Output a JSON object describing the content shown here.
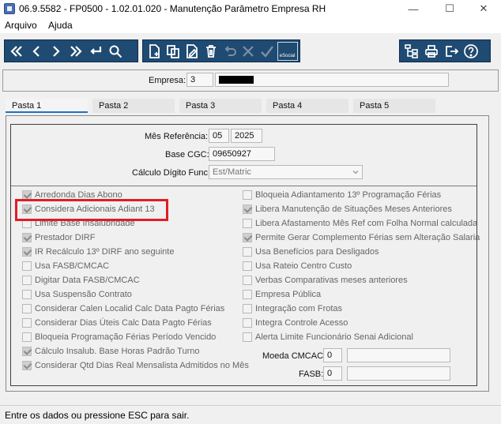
{
  "window": {
    "title": "06.9.5582 - FP0500 - 1.02.01.020 - Manutenção Parâmetro Empresa RH",
    "minimize": "—",
    "maximize": "☐",
    "close": "✕"
  },
  "menu": {
    "items": [
      "Arquivo",
      "Ajuda"
    ]
  },
  "toolbar": {
    "esocial_label": "eSocial"
  },
  "empresa": {
    "label": "Empresa:",
    "code": "3",
    "name_redacted": "",
    "extra": ""
  },
  "tabs": [
    "Pasta 1",
    "Pasta 2",
    "Pasta 3",
    "Pasta 4",
    "Pasta 5"
  ],
  "form": {
    "mes_referencia": {
      "label": "Mês Referência:",
      "month": "05",
      "year": "2025"
    },
    "base_cgc": {
      "label": "Base CGC:",
      "value": "09650927"
    },
    "calculo_digito": {
      "label": "Cálculo Dígito Func:",
      "value": "Est/Matric"
    }
  },
  "checkboxes_left": [
    {
      "label": "Arredonda Dias Abono",
      "checked": true
    },
    {
      "label": "Considera Adicionais Adiant 13",
      "checked": true
    },
    {
      "label": "Limite Base Insalubridade",
      "checked": false
    },
    {
      "label": "Prestador DIRF",
      "checked": true
    },
    {
      "label": "IR Recálculo 13º DIRF ano seguinte",
      "checked": true
    },
    {
      "label": "Usa FASB/CMCAC",
      "checked": false
    },
    {
      "label": "Digitar Data FASB/CMCAC",
      "checked": false
    },
    {
      "label": "Usa Suspensão Contrato",
      "checked": false
    },
    {
      "label": "Considerar Calen Localid Calc Data Pagto Férias",
      "checked": false
    },
    {
      "label": "Considerar Dias Úteis Calc Data Pagto Férias",
      "checked": false
    },
    {
      "label": "Bloqueia Programação Férias Período Vencido",
      "checked": false
    },
    {
      "label": "Cálculo Insalub. Base Horas Padrão Turno",
      "checked": true
    },
    {
      "label": "Considerar Qtd Dias Real Mensalista Admitidos no Mês",
      "checked": true
    }
  ],
  "checkboxes_right": [
    {
      "label": "Bloqueia Adiantamento 13º Programação Férias",
      "checked": false
    },
    {
      "label": "Libera Manutenção de Situações Meses Anteriores",
      "checked": true
    },
    {
      "label": "Libera Afastamento Mês Ref com Folha Normal calculada",
      "checked": false
    },
    {
      "label": "Permite Gerar Complemento Férias sem Alteração Salaria",
      "checked": true
    },
    {
      "label": "Usa Benefícios para Desligados",
      "checked": false
    },
    {
      "label": "Usa Rateio Centro Custo",
      "checked": false
    },
    {
      "label": "Verbas Comparativas meses anteriores",
      "checked": false
    },
    {
      "label": "Empresa Pública",
      "checked": false
    },
    {
      "label": "Integração com Frotas",
      "checked": false
    },
    {
      "label": "Integra Controle Acesso",
      "checked": false
    },
    {
      "label": "Alerta Limite Funcionário Senai Adicional",
      "checked": false
    }
  ],
  "moeda_cmcac": {
    "label": "Moeda CMCAC:",
    "value": "0",
    "desc": ""
  },
  "fasb": {
    "label": "FASB:",
    "value": "0",
    "desc": ""
  },
  "status_bar": {
    "text": "Entre os dados ou pressione ESC para sair."
  },
  "colors": {
    "toolbar_bg": "#1f4a72",
    "highlight": "#e01e24",
    "tab_active": "#1a73c8"
  }
}
